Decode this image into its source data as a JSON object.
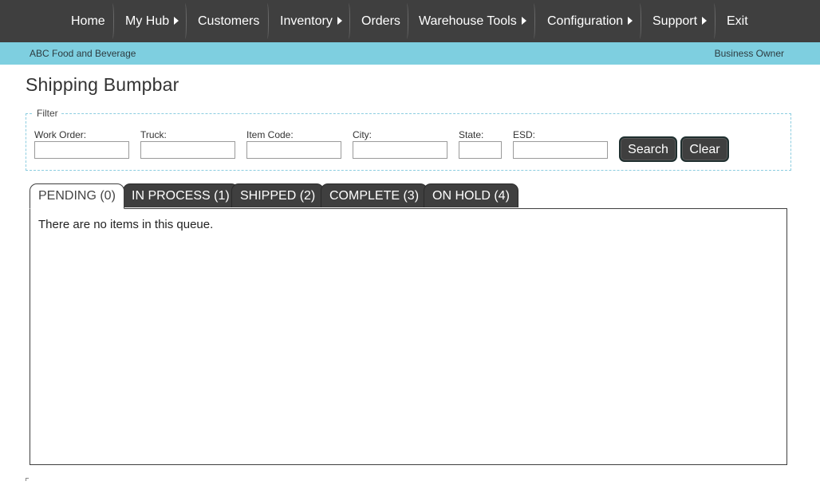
{
  "nav": {
    "items": [
      {
        "label": "Home",
        "has_submenu": false
      },
      {
        "label": "My Hub",
        "has_submenu": true
      },
      {
        "label": "Customers",
        "has_submenu": false
      },
      {
        "label": "Inventory",
        "has_submenu": true
      },
      {
        "label": "Orders",
        "has_submenu": false
      },
      {
        "label": "Warehouse Tools",
        "has_submenu": true
      },
      {
        "label": "Configuration",
        "has_submenu": true
      },
      {
        "label": "Support",
        "has_submenu": true
      },
      {
        "label": "Exit",
        "has_submenu": false
      }
    ]
  },
  "subheader": {
    "company": "ABC Food and Beverage",
    "role": "Business Owner"
  },
  "page": {
    "title": "Shipping Bumpbar"
  },
  "filter": {
    "legend": "Filter",
    "fields": {
      "work_order": {
        "label": "Work Order:",
        "value": ""
      },
      "truck": {
        "label": "Truck:",
        "value": ""
      },
      "item_code": {
        "label": "Item Code:",
        "value": ""
      },
      "city": {
        "label": "City:",
        "value": ""
      },
      "state": {
        "label": "State:",
        "value": ""
      },
      "esd": {
        "label": "ESD:",
        "value": ""
      }
    },
    "search_label": "Search",
    "clear_label": "Clear"
  },
  "tabs": [
    {
      "label": "PENDING (0)",
      "active": true
    },
    {
      "label": "IN PROCESS (1)",
      "active": false
    },
    {
      "label": "SHIPPED (2)",
      "active": false
    },
    {
      "label": "COMPLETE (3)",
      "active": false
    },
    {
      "label": "ON HOLD (4)",
      "active": false
    }
  ],
  "panel": {
    "empty_message": "There are no items in this queue."
  },
  "colors": {
    "nav_bg": "#3f3f3f",
    "subheader_bg": "#7ecfe0",
    "filter_border": "#8ccde0"
  }
}
